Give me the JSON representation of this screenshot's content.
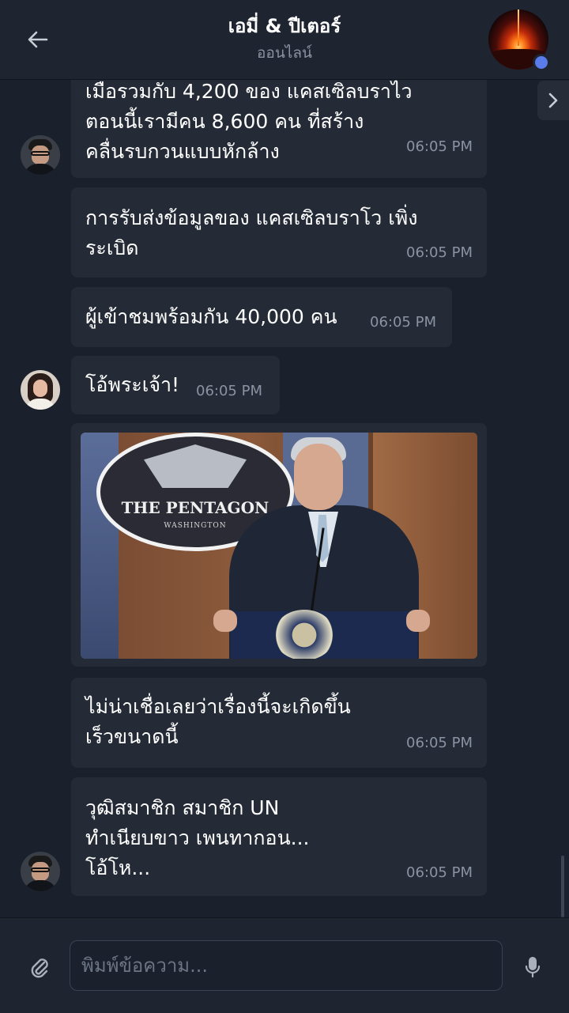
{
  "header": {
    "title": "เอมี่ & ปีเตอร์",
    "status": "ออนไลน์",
    "back_icon": "arrow-left-icon",
    "avatar_icon": "chat-avatar",
    "status_color": "#5a7bea"
  },
  "messages": [
    {
      "sender": "peter",
      "text": "เมือรวมกับ 4,200 ของ แคสเซิลบราไว\nตอนนี้เรามีคน 8,600 คน ที่สร้าง\nคลื่นรบกวนแบบหักล้าง",
      "time": "06:05 PM"
    },
    {
      "sender": "peter",
      "text": "การรับส่งข้อมูลของ แคสเซิลบราโว เพิ่ง\nระเบิด",
      "time": "06:05 PM"
    },
    {
      "sender": "peter",
      "text": "ผู้เข้าชมพร้อมกัน 40,000 คน",
      "time": "06:05 PM"
    },
    {
      "sender": "amy",
      "text": "โอ้พระเจ้า!",
      "time": "06:05 PM"
    },
    {
      "sender": "peter",
      "type": "image",
      "image": {
        "seal_title": "THE PENTAGON",
        "seal_subtitle": "WASHINGTON"
      }
    },
    {
      "sender": "peter",
      "text": "ไม่น่าเชื่อเลยว่าเรื่องนี้จะเกิดขึ้น\nเร็วขนาดนี้",
      "time": "06:05 PM"
    },
    {
      "sender": "peter",
      "text": "วุฒิสมาชิก สมาชิก UN\nทำเนียบขาว เพนทากอน...\nโอ้โห...",
      "time": "06:05 PM"
    }
  ],
  "composer": {
    "placeholder": "พิมพ์ข้อความ...",
    "attach_icon": "paperclip-icon",
    "mic_icon": "microphone-icon"
  },
  "colors": {
    "background": "#1b212c",
    "bubble": "#242b36",
    "time": "#8a93a3"
  }
}
